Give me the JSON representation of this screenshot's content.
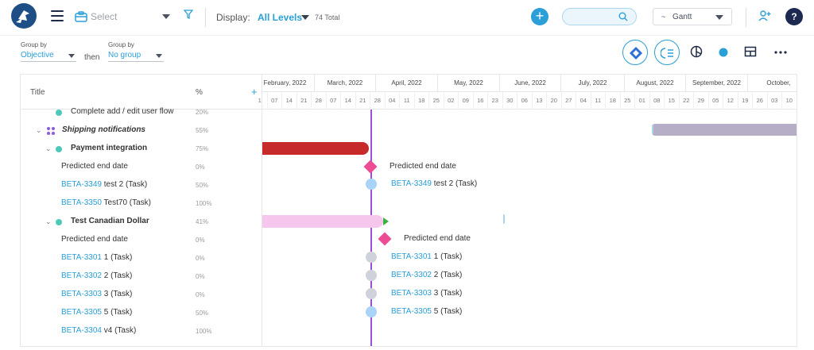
{
  "header": {
    "select_placeholder": "Select",
    "display_label": "Display:",
    "display_value": "All Levels",
    "total_text": "74 Total",
    "view_label": "Gantt",
    "help_label": "?",
    "add_label": "+"
  },
  "toolbar": {
    "group_by_label_1": "Group by",
    "group_by_value_1": "Objective",
    "then_label": "then",
    "group_by_label_2": "Group by",
    "group_by_value_2": "No group"
  },
  "table": {
    "title_header": "Title",
    "pct_header": "%",
    "add_column": "+",
    "rows": [
      {
        "label": "Complete add / edit user flow",
        "key": "",
        "pct": "20%"
      },
      {
        "label": "Shipping notifications",
        "key": "",
        "pct": "55%"
      },
      {
        "label": "Payment integration",
        "key": "",
        "pct": "75%"
      },
      {
        "label": "Predicted end date",
        "key": "",
        "pct": "0%"
      },
      {
        "label": " test 2 (Task)",
        "key": "BETA-3349",
        "pct": "50%"
      },
      {
        "label": " Test70 (Task)",
        "key": "BETA-3350",
        "pct": "100%"
      },
      {
        "label": "Test Canadian Dollar",
        "key": "",
        "pct": "41%"
      },
      {
        "label": "Predicted end date",
        "key": "",
        "pct": "0%"
      },
      {
        "label": " 1 (Task)",
        "key": "BETA-3301",
        "pct": "0%"
      },
      {
        "label": " 2 (Task)",
        "key": "BETA-3302",
        "pct": "0%"
      },
      {
        "label": " 3 (Task)",
        "key": "BETA-3303",
        "pct": "0%"
      },
      {
        "label": " 5 (Task)",
        "key": "BETA-3305",
        "pct": "50%"
      },
      {
        "label": " v4 (Task)",
        "key": "BETA-3304",
        "pct": "100%"
      }
    ]
  },
  "timeline": {
    "months": [
      "February, 2022",
      "March, 2022",
      "April, 2022",
      "May, 2022",
      "June, 2022",
      "July, 2022",
      "August, 2022",
      "September, 2022",
      "October,"
    ],
    "days": [
      "1",
      "07",
      "14",
      "21",
      "28",
      "07",
      "14",
      "21",
      "28",
      "04",
      "11",
      "18",
      "25",
      "02",
      "09",
      "16",
      "23",
      "30",
      "06",
      "13",
      "20",
      "27",
      "04",
      "11",
      "18",
      "25",
      "01",
      "08",
      "15",
      "22",
      "29",
      "05",
      "12",
      "19",
      "26",
      "03",
      "10",
      "17"
    ],
    "labels": {
      "predicted_1": "Predicted end date",
      "task_3349_key": "BETA-3349",
      "task_3349": " test 2 (Task)",
      "predicted_2": "Predicted end date",
      "task_3301_key": "BETA-3301",
      "task_3301": " 1 (Task)",
      "task_3302_key": "BETA-3302",
      "task_3302": " 2 (Task)",
      "task_3303_key": "BETA-3303",
      "task_3303": " 3 (Task)",
      "task_3305_key": "BETA-3305",
      "task_3305": " 5 (Task)"
    }
  },
  "colors": {
    "accent": "#2a9fd8",
    "bar_red": "#c62a2a",
    "bar_pink": "#f6c6ec",
    "today_line": "#9b4fd6",
    "diamond": "#ec4c94"
  }
}
